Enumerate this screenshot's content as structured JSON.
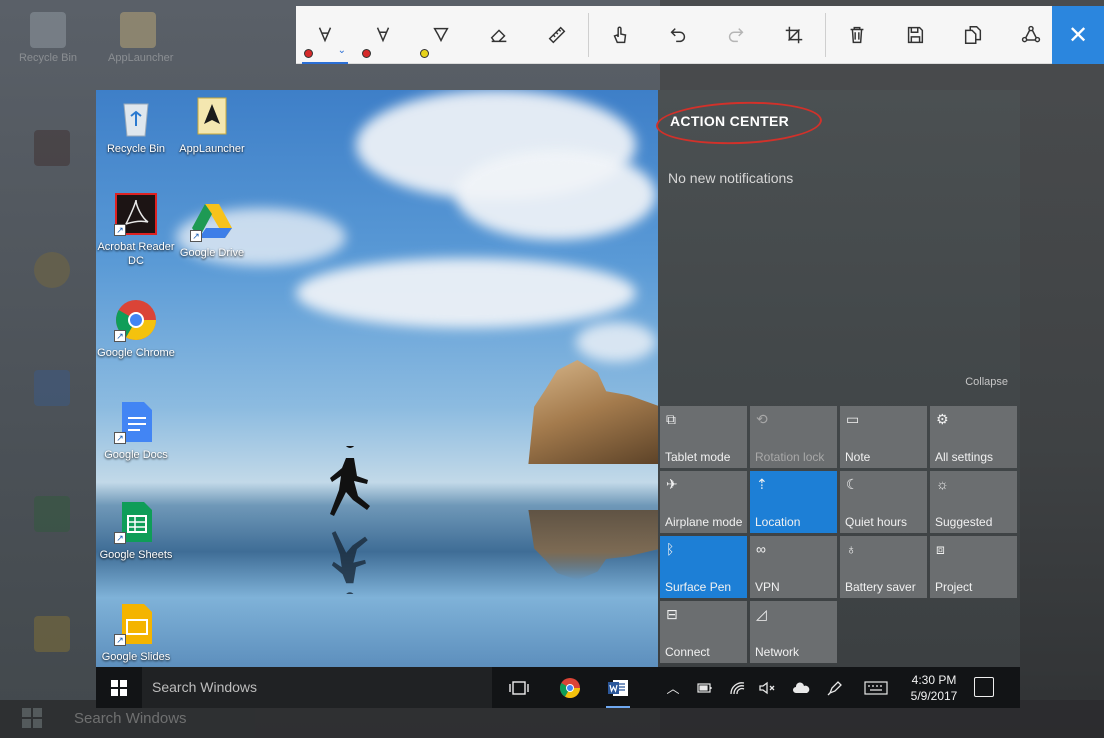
{
  "outer": {
    "icons": [
      {
        "name": "recycle",
        "label": "Recycle Bin"
      },
      {
        "name": "applauncher",
        "label": "AppLauncher"
      }
    ],
    "search_text": "Search Windows"
  },
  "toolbar": {
    "tools": [
      {
        "name": "ballpoint-pen",
        "icon": "pen-icon",
        "color": "#d62a2a",
        "selected": true
      },
      {
        "name": "pencil",
        "icon": "pencil-icon",
        "color": "#d62a2a"
      },
      {
        "name": "highlighter",
        "icon": "highlighter-icon",
        "color": "#e6d21a"
      },
      {
        "name": "eraser",
        "icon": "eraser-icon"
      },
      {
        "name": "ruler",
        "icon": "ruler-icon"
      },
      {
        "name": "touch-writing",
        "icon": "touch-icon"
      },
      {
        "name": "undo",
        "icon": "undo-icon"
      },
      {
        "name": "redo",
        "icon": "redo-icon"
      },
      {
        "name": "crop",
        "icon": "crop-icon"
      },
      {
        "name": "delete",
        "icon": "trash-icon"
      },
      {
        "name": "save",
        "icon": "save-icon"
      },
      {
        "name": "copy",
        "icon": "copy-icon"
      },
      {
        "name": "share",
        "icon": "share-icon"
      }
    ],
    "close_label": "✕"
  },
  "desktop": {
    "icons": [
      {
        "label": "Recycle Bin",
        "icon": "recycle-bin-icon"
      },
      {
        "label": "AppLauncher",
        "icon": "app-launcher-icon"
      },
      {
        "label": "Acrobat Reader DC",
        "icon": "acrobat-icon"
      },
      {
        "label": "Google Drive",
        "icon": "google-drive-icon"
      },
      {
        "label": "Google Chrome",
        "icon": "chrome-icon"
      },
      {
        "label": "Google Docs",
        "icon": "google-docs-icon"
      },
      {
        "label": "Google Sheets",
        "icon": "google-sheets-icon"
      },
      {
        "label": "Google Slides",
        "icon": "google-slides-icon"
      }
    ]
  },
  "action_center": {
    "title": "ACTION CENTER",
    "empty_text": "No new notifications",
    "collapse_label": "Collapse",
    "annotation_color": "#d2312a",
    "quick_actions": [
      {
        "label": "Tablet mode",
        "icon": "tablet-mode-icon",
        "glyph": "⧉",
        "state": "off"
      },
      {
        "label": "Rotation lock",
        "icon": "rotation-lock-icon",
        "glyph": "⟲",
        "state": "disabled"
      },
      {
        "label": "Note",
        "icon": "note-icon",
        "glyph": "▭",
        "state": "off"
      },
      {
        "label": "All settings",
        "icon": "gear-icon",
        "glyph": "⚙",
        "state": "off"
      },
      {
        "label": "Airplane mode",
        "icon": "airplane-icon",
        "glyph": "✈",
        "state": "off"
      },
      {
        "label": "Location",
        "icon": "location-icon",
        "glyph": "⇡",
        "state": "on"
      },
      {
        "label": "Quiet hours",
        "icon": "moon-icon",
        "glyph": "☾",
        "state": "off"
      },
      {
        "label": "Suggested",
        "icon": "brightness-icon",
        "glyph": "☼",
        "state": "off"
      },
      {
        "label": "Surface Pen",
        "icon": "bluetooth-icon",
        "glyph": "ᛒ",
        "state": "on"
      },
      {
        "label": "VPN",
        "icon": "vpn-icon",
        "glyph": "∞",
        "state": "off"
      },
      {
        "label": "Battery saver",
        "icon": "battery-saver-icon",
        "glyph": "♁",
        "state": "off"
      },
      {
        "label": "Project",
        "icon": "project-icon",
        "glyph": "⧈",
        "state": "off"
      },
      {
        "label": "Connect",
        "icon": "connect-icon",
        "glyph": "⊟",
        "state": "off"
      },
      {
        "label": "Network",
        "icon": "network-icon",
        "glyph": "◿",
        "state": "off"
      }
    ]
  },
  "taskbar": {
    "search_placeholder": "Search Windows",
    "time": "4:30 PM",
    "date": "5/9/2017",
    "tray_icons": [
      "chevron-up-icon",
      "battery-icon",
      "wifi-icon",
      "volume-mute-icon",
      "onedrive-icon",
      "pen-icon",
      "keyboard-icon"
    ]
  }
}
